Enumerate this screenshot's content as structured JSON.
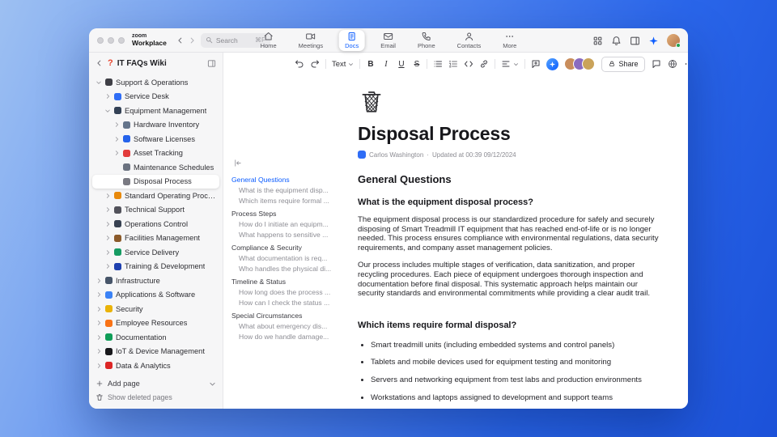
{
  "titlebar": {
    "brand_line1": "zoom",
    "brand_line2": "Workplace",
    "search": {
      "placeholder": "Search",
      "shortcut": "⌘F"
    },
    "nav": [
      {
        "label": "Home",
        "icon": "home-icon",
        "active": false
      },
      {
        "label": "Meetings",
        "icon": "video-icon",
        "active": false
      },
      {
        "label": "Docs",
        "icon": "doc-icon",
        "active": true
      },
      {
        "label": "Email",
        "icon": "mail-icon",
        "active": false
      },
      {
        "label": "Phone",
        "icon": "phone-icon",
        "active": false
      },
      {
        "label": "Contacts",
        "icon": "contacts-icon",
        "active": false
      },
      {
        "label": "More",
        "icon": "more-icon",
        "active": false
      }
    ]
  },
  "sidebar": {
    "title": "IT FAQs Wiki",
    "tree": [
      {
        "label": "Support & Operations",
        "icon": "phone-icon",
        "color": "#3f3f46",
        "level": 0,
        "state": "expanded",
        "selected": false
      },
      {
        "label": "Service Desk",
        "icon": "service-bell-icon",
        "color": "#2f6df6",
        "level": 1,
        "state": "collapsed",
        "selected": false
      },
      {
        "label": "Equipment Management",
        "icon": "desktop-icon",
        "color": "#334155",
        "level": 1,
        "state": "expanded",
        "selected": false
      },
      {
        "label": "Hardware Inventory",
        "icon": "wrench-icon",
        "color": "#64748b",
        "level": 2,
        "state": "collapsed",
        "selected": false
      },
      {
        "label": "Software Licenses",
        "icon": "disc-icon",
        "color": "#2563eb",
        "level": 2,
        "state": "collapsed",
        "selected": false
      },
      {
        "label": "Asset Tracking",
        "icon": "pin-icon",
        "color": "#e23b3b",
        "level": 2,
        "state": "collapsed",
        "selected": false
      },
      {
        "label": "Maintenance Schedules",
        "icon": "tools-icon",
        "color": "#6b7280",
        "level": 2,
        "state": "leaf",
        "selected": false
      },
      {
        "label": "Disposal Process",
        "icon": "trash-icon",
        "color": "#7a7a82",
        "level": 2,
        "state": "leaf",
        "selected": true
      },
      {
        "label": "Standard Operating Procedures",
        "icon": "clipboard-icon",
        "color": "#e8890c",
        "level": 1,
        "state": "collapsed",
        "selected": false
      },
      {
        "label": "Technical Support",
        "icon": "wrench-icon",
        "color": "#52525b",
        "level": 1,
        "state": "collapsed",
        "selected": false
      },
      {
        "label": "Operations Control",
        "icon": "control-panel-icon",
        "color": "#374151",
        "level": 1,
        "state": "collapsed",
        "selected": false
      },
      {
        "label": "Facilities Management",
        "icon": "building-icon",
        "color": "#8b5a2b",
        "level": 1,
        "state": "collapsed",
        "selected": false
      },
      {
        "label": "Service Delivery",
        "icon": "delivery-icon",
        "color": "#169b62",
        "level": 1,
        "state": "collapsed",
        "selected": false
      },
      {
        "label": "Training & Development",
        "icon": "graduation-icon",
        "color": "#1e40af",
        "level": 1,
        "state": "collapsed",
        "selected": false
      },
      {
        "label": "Infrastructure",
        "icon": "server-icon",
        "color": "#475569",
        "level": 0,
        "state": "collapsed",
        "selected": false
      },
      {
        "label": "Applications & Software",
        "icon": "apps-icon",
        "color": "#3b82f6",
        "level": 0,
        "state": "collapsed",
        "selected": false
      },
      {
        "label": "Security",
        "icon": "shield-icon",
        "color": "#eab308",
        "level": 0,
        "state": "collapsed",
        "selected": false
      },
      {
        "label": "Employee Resources",
        "icon": "people-icon",
        "color": "#f97316",
        "level": 0,
        "state": "collapsed",
        "selected": false
      },
      {
        "label": "Documentation",
        "icon": "books-icon",
        "color": "#0f9d58",
        "level": 0,
        "state": "collapsed",
        "selected": false
      },
      {
        "label": "IoT & Device Management",
        "icon": "device-icon",
        "color": "#18181b",
        "level": 0,
        "state": "collapsed",
        "selected": false
      },
      {
        "label": "Data & Analytics",
        "icon": "chart-icon",
        "color": "#dc2626",
        "level": 0,
        "state": "collapsed",
        "selected": false
      }
    ],
    "add_page": "Add page",
    "show_deleted": "Show deleted pages"
  },
  "toc": {
    "items": [
      {
        "label": "General Questions",
        "type": "section",
        "active": true
      },
      {
        "label": "What is the equipment disp...",
        "type": "sub",
        "active": false
      },
      {
        "label": "Which items require formal ...",
        "type": "sub",
        "active": false
      },
      {
        "label": "Process Steps",
        "type": "section",
        "active": false
      },
      {
        "label": "How do I initiate an equipm...",
        "type": "sub",
        "active": false
      },
      {
        "label": "What happens to sensitive ...",
        "type": "sub",
        "active": false
      },
      {
        "label": "Compliance & Security",
        "type": "section",
        "active": false
      },
      {
        "label": "What documentation is req...",
        "type": "sub",
        "active": false
      },
      {
        "label": "Who handles the physical di...",
        "type": "sub",
        "active": false
      },
      {
        "label": "Timeline & Status",
        "type": "section",
        "active": false
      },
      {
        "label": "How long does the process ...",
        "type": "sub",
        "active": false
      },
      {
        "label": "How can I check the status ...",
        "type": "sub",
        "active": false
      },
      {
        "label": "Special Circumstances",
        "type": "section",
        "active": false
      },
      {
        "label": "What about emergency dis...",
        "type": "sub",
        "active": false
      },
      {
        "label": "How do we handle damage...",
        "type": "sub",
        "active": false
      }
    ]
  },
  "editor_toolbar": {
    "text_style": "Text",
    "format_buttons": [
      {
        "label": "B",
        "style": "bold"
      },
      {
        "label": "I",
        "style": "italic"
      },
      {
        "label": "U",
        "style": "underline"
      },
      {
        "label": "S",
        "style": "strikethrough"
      }
    ],
    "collaborators": [
      {
        "color": "#c98d5c"
      },
      {
        "color": "#8a6bbf"
      },
      {
        "color": "#caa35a"
      }
    ],
    "share_label": "Share"
  },
  "document": {
    "title": "Disposal Process",
    "author": "Carlos Washington",
    "updated": "Updated at 00:39 09/12/2024",
    "h2": "General Questions",
    "q1": {
      "heading": "What is the equipment disposal process?",
      "p1": "The equipment disposal process is our standardized procedure for safely and securely disposing of Smart Treadmill IT equipment that has reached end-of-life or is no longer needed. This process ensures compliance with environmental regulations, data security requirements, and company asset management policies.",
      "p2": "Our process includes multiple stages of verification, data sanitization, and proper recycling procedures. Each piece of equipment undergoes thorough inspection and documentation before final disposal. This systematic approach helps maintain our security standards and environmental commitments while providing a clear audit trail."
    },
    "q2": {
      "heading": "Which items require formal disposal?",
      "bullets": [
        "Smart treadmill units (including embedded systems and control panels)",
        "Tablets and mobile devices used for equipment testing and monitoring",
        "Servers and networking equipment from test labs and production environments",
        "Workstations and laptops assigned to development and support teams"
      ]
    }
  }
}
